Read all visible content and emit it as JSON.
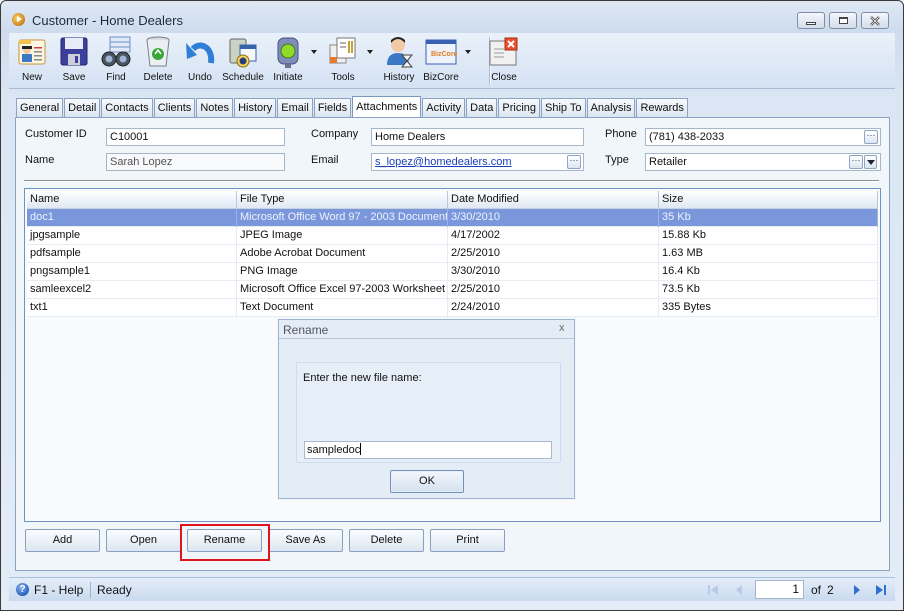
{
  "window": {
    "title": "Customer - Home Dealers",
    "controls": [
      "minimize",
      "maximize",
      "close"
    ]
  },
  "toolbar": {
    "items": [
      {
        "label": "New",
        "icon": "new-contact-card-icon"
      },
      {
        "label": "Save",
        "icon": "floppy-disk-icon"
      },
      {
        "label": "Find",
        "icon": "binoculars-icon"
      },
      {
        "label": "Delete",
        "icon": "recycle-bin-icon"
      },
      {
        "label": "Undo",
        "icon": "undo-arrow-icon"
      },
      {
        "label": "Schedule",
        "icon": "schedule-calendar-icon"
      },
      {
        "label": "Initiate",
        "icon": "traffic-light-icon",
        "dropdown": true
      },
      {
        "label": "Tools",
        "icon": "tools-icon",
        "dropdown": true
      },
      {
        "label": "History",
        "icon": "history-person-hourglass-icon"
      },
      {
        "label": "BizCore",
        "icon": "bizcore-window-icon",
        "dropdown": true
      },
      {
        "label": "Close",
        "icon": "close-window-icon"
      }
    ]
  },
  "tabs": [
    {
      "label": "General"
    },
    {
      "label": "Detail"
    },
    {
      "label": "Contacts"
    },
    {
      "label": "Clients"
    },
    {
      "label": "Notes"
    },
    {
      "label": "History"
    },
    {
      "label": "Email"
    },
    {
      "label": "Fields"
    },
    {
      "label": "Attachments",
      "active": true
    },
    {
      "label": "Activity"
    },
    {
      "label": "Data"
    },
    {
      "label": "Pricing"
    },
    {
      "label": "Ship To"
    },
    {
      "label": "Analysis"
    },
    {
      "label": "Rewards"
    }
  ],
  "form": {
    "customer_id_label": "Customer ID",
    "customer_id": "C10001",
    "name_label": "Name",
    "name": "Sarah Lopez",
    "company_label": "Company",
    "company": "Home Dealers",
    "email_label": "Email",
    "email": "s_lopez@homedealers.com",
    "phone_label": "Phone",
    "phone": "(781) 438-2033",
    "type_label": "Type",
    "type": "Retailer",
    "ellipsis": "···"
  },
  "grid": {
    "columns": [
      "Name",
      "File Type",
      "Date Modified",
      "Size"
    ],
    "rows": [
      {
        "name": "doc1",
        "type": "Microsoft Office Word 97 - 2003 Document",
        "date": "3/30/2010",
        "size": "35 Kb",
        "selected": true
      },
      {
        "name": "jpgsample",
        "type": "JPEG Image",
        "date": "4/17/2002",
        "size": "15.88 Kb"
      },
      {
        "name": "pdfsample",
        "type": "Adobe Acrobat Document",
        "date": "2/25/2010",
        "size": "1.63 MB"
      },
      {
        "name": "pngsample1",
        "type": "PNG Image",
        "date": "3/30/2010",
        "size": "16.4 Kb"
      },
      {
        "name": "samleexcel2",
        "type": "Microsoft Office Excel 97-2003 Worksheet",
        "date": "2/25/2010",
        "size": "73.5 Kb"
      },
      {
        "name": "txt1",
        "type": "Text Document",
        "date": "2/24/2010",
        "size": "335 Bytes"
      }
    ]
  },
  "buttons": {
    "add": "Add",
    "open": "Open",
    "rename": "Rename",
    "save_as": "Save As",
    "delete": "Delete",
    "print": "Print"
  },
  "highlight_color": "#e0141b",
  "dialog": {
    "title": "Rename",
    "close": "x",
    "prompt": "Enter the new file name:",
    "value": "sampledoc",
    "ok": "OK"
  },
  "statusbar": {
    "help": "F1 - Help",
    "status": "Ready",
    "page": "1",
    "of_label": "of",
    "total_pages": "2"
  },
  "colors": {
    "selection": "#7a97dc",
    "link": "#1a3fb8"
  }
}
